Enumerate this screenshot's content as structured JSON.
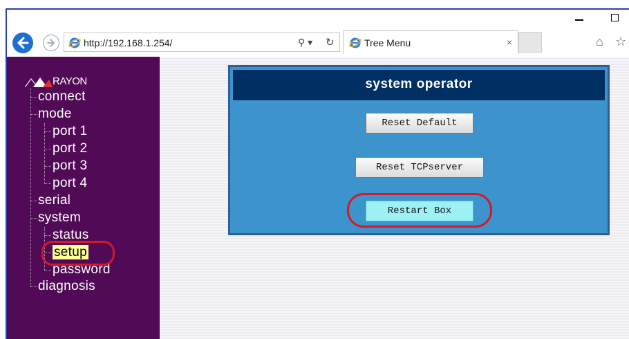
{
  "browser": {
    "address": "http://192.168.1.254/",
    "search_glyph": "⚲",
    "search_dropdown": "▾",
    "refresh_glyph": "↻",
    "tab_title": "Tree Menu",
    "tab_close": "×"
  },
  "sidebar": {
    "logo_text": "RAYON",
    "items": [
      {
        "label": "connect"
      },
      {
        "label": "mode"
      },
      {
        "label": "port 1"
      },
      {
        "label": "port 2"
      },
      {
        "label": "port 3"
      },
      {
        "label": "port 4"
      },
      {
        "label": "serial"
      },
      {
        "label": "system"
      },
      {
        "label": "status"
      },
      {
        "label": "setup",
        "selected": true
      },
      {
        "label": "password"
      },
      {
        "label": "diagnosis"
      }
    ]
  },
  "panel": {
    "title": "system operator",
    "buttons": [
      {
        "label": "Reset Default"
      },
      {
        "label": "Reset TCPserver"
      },
      {
        "label": "Restart Box",
        "highlighted": true
      }
    ]
  },
  "colors": {
    "sidebar_bg": "#510a55",
    "panel_bg": "#3d93cc",
    "panel_header": "#002f63",
    "callout": "#d11a2a",
    "selected_highlight": "#ffff99",
    "active_button": "#9df1f5"
  }
}
